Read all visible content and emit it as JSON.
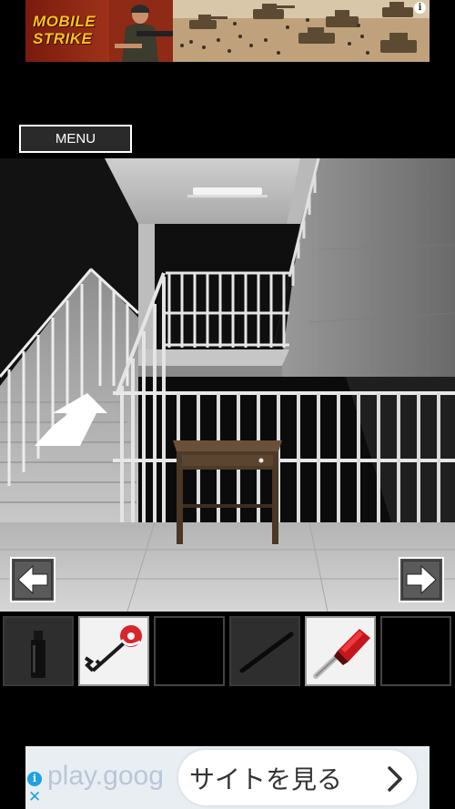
{
  "top_ad": {
    "title": "MOBILE STRIKE",
    "info_glyph": "i",
    "icon": "info-icon"
  },
  "menu": {
    "label": "MENU"
  },
  "scene": {
    "description_icon": "stairwell-scene",
    "colors": {
      "wall": "#cfcfcf",
      "floor": "#b9b9b9",
      "dark": "#151515",
      "table": "#5a4330"
    }
  },
  "navigation": {
    "left_icon": "arrow-left-icon",
    "right_icon": "arrow-right-icon",
    "up_icon": "arrow-up-icon"
  },
  "inventory": {
    "slots": [
      {
        "item": "bottle-icon",
        "selected": false
      },
      {
        "item": "key-icon",
        "selected": true
      },
      {
        "item": "",
        "selected": false
      },
      {
        "item": "stick-icon",
        "selected": false
      },
      {
        "item": "screwdriver-icon",
        "selected": true
      },
      {
        "item": "",
        "selected": false
      }
    ]
  },
  "bottom_ad": {
    "url_text": "play.goog",
    "cta_label": "サイトを見る",
    "chevron_icon": "chevron-right-icon",
    "info_glyph": "i",
    "close_glyph": "✕"
  }
}
